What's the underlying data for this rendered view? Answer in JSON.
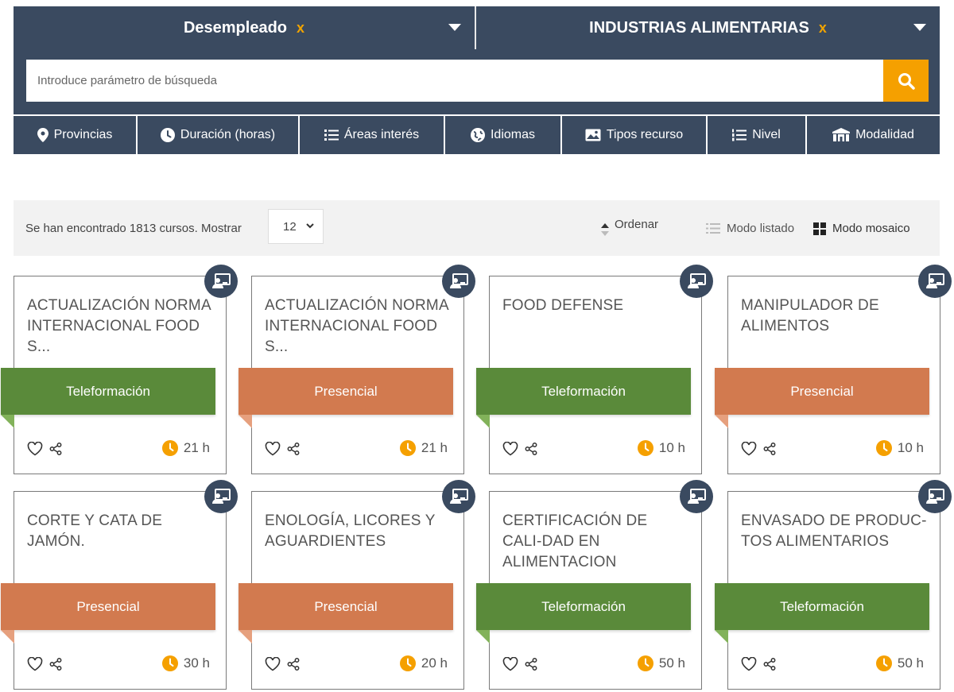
{
  "filters": {
    "left_select": {
      "label": "Desempleado",
      "remove": "x"
    },
    "right_select": {
      "label": "INDUSTRIAS ALIMENTARIAS",
      "remove": "x"
    }
  },
  "search": {
    "placeholder": "Introduce parámetro de búsqueda",
    "value": ""
  },
  "tabs": [
    {
      "label": "Provincias",
      "icon": "map-pin-icon"
    },
    {
      "label": "Duración (horas)",
      "icon": "clock-icon"
    },
    {
      "label": "Áreas interés",
      "icon": "list-icon"
    },
    {
      "label": "Idiomas",
      "icon": "globe-icon"
    },
    {
      "label": "Tipos recurso",
      "icon": "image-icon"
    },
    {
      "label": "Nivel",
      "icon": "numbered-list-icon"
    },
    {
      "label": "Modalidad",
      "icon": "building-icon"
    }
  ],
  "results": {
    "found_text": "Se han encontrado 1813 cursos. Mostrar",
    "per_page": "12",
    "order_label": "Ordenar",
    "list_mode_label": "Modo listado",
    "grid_mode_label": "Modo mosaico"
  },
  "colors": {
    "header": "#3a4a60",
    "accent": "#f5a000",
    "teleformacion": "#5a8a3a",
    "presencial": "#d27a4f"
  },
  "cards": [
    {
      "title": "ACTUALIZACIÓN NORMA INTERNACIONAL FOOD S...",
      "modality": "Teleformación",
      "hours": "21 h"
    },
    {
      "title": "ACTUALIZACIÓN NORMA INTERNACIONAL FOOD S...",
      "modality": "Presencial",
      "hours": "21 h"
    },
    {
      "title": "FOOD DEFENSE",
      "modality": "Teleformación",
      "hours": "10 h"
    },
    {
      "title": "MANIPULADOR DE ALIMENTOS",
      "modality": "Presencial",
      "hours": "10 h"
    },
    {
      "title": "CORTE Y CATA DE JAMÓN.",
      "modality": "Presencial",
      "hours": "30 h"
    },
    {
      "title": "ENOLOGÍA, LICORES Y AGUARDIENTES",
      "modality": "Presencial",
      "hours": "20 h"
    },
    {
      "title": "CERTIFICACIÓN DE CALI-DAD EN ALIMENTACION",
      "modality": "Teleformación",
      "hours": "50 h"
    },
    {
      "title": "ENVASADO DE PRODUC-TOS ALIMENTARIOS",
      "modality": "Teleformación",
      "hours": "50 h"
    }
  ]
}
